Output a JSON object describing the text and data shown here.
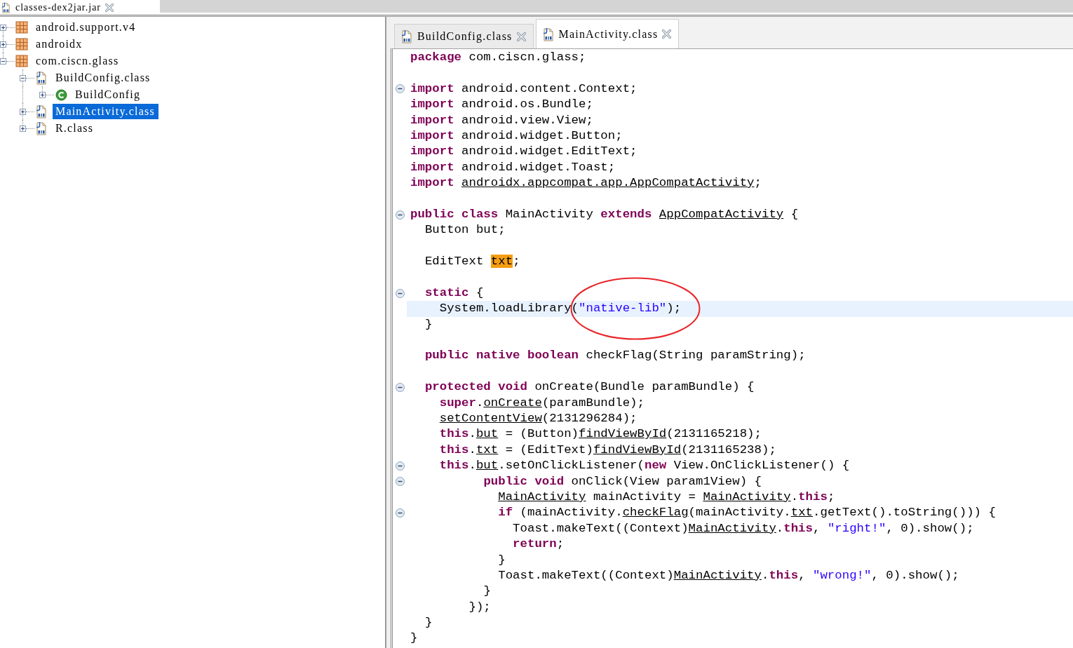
{
  "top_tab": {
    "label": "classes-dex2jar.jar"
  },
  "tree": [
    {
      "label": "android.support.v4",
      "kind": "package",
      "expanded": false,
      "selected": false
    },
    {
      "label": "androidx",
      "kind": "package",
      "expanded": false,
      "selected": false
    },
    {
      "label": "com.ciscn.glass",
      "kind": "package",
      "expanded": true,
      "selected": false,
      "children": [
        {
          "label": "BuildConfig.class",
          "kind": "classfile",
          "expanded": true,
          "selected": false,
          "children": [
            {
              "label": "BuildConfig",
              "kind": "class",
              "expanded": false,
              "selected": false
            }
          ]
        },
        {
          "label": "MainActivity.class",
          "kind": "classfile",
          "expanded": false,
          "selected": true
        },
        {
          "label": "R.class",
          "kind": "classfile",
          "expanded": false,
          "selected": false
        }
      ]
    }
  ],
  "editor_tabs": [
    {
      "label": "BuildConfig.class",
      "selected": false
    },
    {
      "label": "MainActivity.class",
      "selected": true
    }
  ],
  "code": [
    {
      "fold": false,
      "current": false,
      "tokens": [
        {
          "kind": "keyword",
          "text": "package "
        },
        {
          "kind": "plain",
          "text": "com.ciscn.glass;"
        }
      ]
    },
    {
      "fold": false,
      "current": false
    },
    {
      "fold": true,
      "current": false,
      "tokens": [
        {
          "kind": "keyword",
          "text": "import "
        },
        {
          "kind": "plain",
          "text": "android.content.Context;"
        }
      ]
    },
    {
      "fold": false,
      "current": false,
      "tokens": [
        {
          "kind": "keyword",
          "text": "import "
        },
        {
          "kind": "plain",
          "text": "android.os.Bundle;"
        }
      ]
    },
    {
      "fold": false,
      "current": false,
      "tokens": [
        {
          "kind": "keyword",
          "text": "import "
        },
        {
          "kind": "plain",
          "text": "android.view.View;"
        }
      ]
    },
    {
      "fold": false,
      "current": false,
      "tokens": [
        {
          "kind": "keyword",
          "text": "import "
        },
        {
          "kind": "plain",
          "text": "android.widget.Button;"
        }
      ]
    },
    {
      "fold": false,
      "current": false,
      "tokens": [
        {
          "kind": "keyword",
          "text": "import "
        },
        {
          "kind": "plain",
          "text": "android.widget.EditText;"
        }
      ]
    },
    {
      "fold": false,
      "current": false,
      "tokens": [
        {
          "kind": "keyword",
          "text": "import "
        },
        {
          "kind": "plain",
          "text": "android.widget.Toast;"
        }
      ]
    },
    {
      "fold": false,
      "current": false,
      "tokens": [
        {
          "kind": "keyword",
          "text": "import "
        },
        {
          "kind": "link",
          "text": "androidx.appcompat.app.AppCompatActivity"
        },
        {
          "kind": "plain",
          "text": ";"
        }
      ]
    },
    {
      "fold": false,
      "current": false
    },
    {
      "fold": true,
      "current": false,
      "tokens": [
        {
          "kind": "keyword",
          "text": "public class "
        },
        {
          "kind": "plain",
          "text": "MainActivity "
        },
        {
          "kind": "keyword",
          "text": "extends "
        },
        {
          "kind": "link",
          "text": "AppCompatActivity"
        },
        {
          "kind": "plain",
          "text": " {"
        }
      ]
    },
    {
      "fold": false,
      "current": false,
      "tokens": [
        {
          "kind": "plain",
          "text": "  Button but;"
        }
      ]
    },
    {
      "fold": false,
      "current": false
    },
    {
      "fold": false,
      "current": false,
      "tokens": [
        {
          "kind": "plain",
          "text": "  EditText "
        },
        {
          "kind": "match",
          "text": "txt"
        },
        {
          "kind": "plain",
          "text": ";"
        }
      ]
    },
    {
      "fold": false,
      "current": false
    },
    {
      "fold": true,
      "current": false,
      "tokens": [
        {
          "kind": "keyword",
          "text": "  static "
        },
        {
          "kind": "plain",
          "text": "{"
        }
      ]
    },
    {
      "fold": false,
      "current": true,
      "tokens": [
        {
          "kind": "plain",
          "text": "    System.loadLibrary("
        },
        {
          "kind": "circled",
          "text": "\"native-lib\""
        },
        {
          "kind": "plain",
          "text": ");"
        }
      ]
    },
    {
      "fold": false,
      "current": false,
      "tokens": [
        {
          "kind": "plain",
          "text": "  }"
        }
      ]
    },
    {
      "fold": false,
      "current": false
    },
    {
      "fold": false,
      "current": false,
      "tokens": [
        {
          "kind": "keyword",
          "text": "  public native boolean "
        },
        {
          "kind": "plain",
          "text": "checkFlag(String paramString);"
        }
      ]
    },
    {
      "fold": false,
      "current": false
    },
    {
      "fold": true,
      "current": false,
      "tokens": [
        {
          "kind": "keyword",
          "text": "  protected void "
        },
        {
          "kind": "plain",
          "text": "onCreate(Bundle paramBundle) {"
        }
      ]
    },
    {
      "fold": false,
      "current": false,
      "tokens": [
        {
          "kind": "keyword",
          "text": "    super"
        },
        {
          "kind": "plain",
          "text": "."
        },
        {
          "kind": "link",
          "text": "onCreate"
        },
        {
          "kind": "plain",
          "text": "(paramBundle);"
        }
      ]
    },
    {
      "fold": false,
      "current": false,
      "tokens": [
        {
          "kind": "link",
          "text": "    setContentView"
        },
        {
          "kind": "plain",
          "text": "(2131296284);"
        }
      ]
    },
    {
      "fold": false,
      "current": false,
      "tokens": [
        {
          "kind": "keyword",
          "text": "    this"
        },
        {
          "kind": "plain",
          "text": "."
        },
        {
          "kind": "link",
          "text": "but"
        },
        {
          "kind": "plain",
          "text": " = (Button)"
        },
        {
          "kind": "link",
          "text": "findViewById"
        },
        {
          "kind": "plain",
          "text": "(2131165218);"
        }
      ]
    },
    {
      "fold": false,
      "current": false,
      "tokens": [
        {
          "kind": "keyword",
          "text": "    this"
        },
        {
          "kind": "plain",
          "text": "."
        },
        {
          "kind": "link",
          "text": "txt"
        },
        {
          "kind": "plain",
          "text": " = (EditText)"
        },
        {
          "kind": "link",
          "text": "findViewById"
        },
        {
          "kind": "plain",
          "text": "(2131165238);"
        }
      ]
    },
    {
      "fold": true,
      "current": false,
      "tokens": [
        {
          "kind": "keyword",
          "text": "    this"
        },
        {
          "kind": "plain",
          "text": "."
        },
        {
          "kind": "link",
          "text": "but"
        },
        {
          "kind": "plain",
          "text": ".setOnClickListener("
        },
        {
          "kind": "keyword",
          "text": "new "
        },
        {
          "kind": "plain",
          "text": "View.OnClickListener() {"
        }
      ]
    },
    {
      "fold": true,
      "current": false,
      "tokens": [
        {
          "kind": "keyword",
          "text": "          public void "
        },
        {
          "kind": "plain",
          "text": "onClick(View param1View) {"
        }
      ]
    },
    {
      "fold": false,
      "current": false,
      "tokens": [
        {
          "kind": "link",
          "text": "            MainActivity"
        },
        {
          "kind": "plain",
          "text": " mainActivity = "
        },
        {
          "kind": "link",
          "text": "MainActivity"
        },
        {
          "kind": "plain",
          "text": "."
        },
        {
          "kind": "keyword",
          "text": "this"
        },
        {
          "kind": "plain",
          "text": ";"
        }
      ]
    },
    {
      "fold": true,
      "current": false,
      "tokens": [
        {
          "kind": "keyword",
          "text": "            if "
        },
        {
          "kind": "plain",
          "text": "(mainActivity."
        },
        {
          "kind": "link",
          "text": "checkFlag"
        },
        {
          "kind": "plain",
          "text": "(mainActivity."
        },
        {
          "kind": "link",
          "text": "txt"
        },
        {
          "kind": "plain",
          "text": ".getText().toString())) {"
        }
      ]
    },
    {
      "fold": false,
      "current": false,
      "tokens": [
        {
          "kind": "plain",
          "text": "              Toast.makeText((Context)"
        },
        {
          "kind": "link",
          "text": "MainActivity"
        },
        {
          "kind": "plain",
          "text": "."
        },
        {
          "kind": "keyword",
          "text": "this"
        },
        {
          "kind": "plain",
          "text": ", "
        },
        {
          "kind": "string",
          "text": "\"right!\""
        },
        {
          "kind": "plain",
          "text": ", 0).show();"
        }
      ]
    },
    {
      "fold": false,
      "current": false,
      "tokens": [
        {
          "kind": "keyword",
          "text": "              return"
        },
        {
          "kind": "plain",
          "text": ";"
        }
      ]
    },
    {
      "fold": false,
      "current": false,
      "tokens": [
        {
          "kind": "plain",
          "text": "            }"
        }
      ]
    },
    {
      "fold": false,
      "current": false,
      "tokens": [
        {
          "kind": "plain",
          "text": "            Toast.makeText((Context)"
        },
        {
          "kind": "link",
          "text": "MainActivity"
        },
        {
          "kind": "plain",
          "text": "."
        },
        {
          "kind": "keyword",
          "text": "this"
        },
        {
          "kind": "plain",
          "text": ", "
        },
        {
          "kind": "string",
          "text": "\"wrong!\""
        },
        {
          "kind": "plain",
          "text": ", 0).show();"
        }
      ]
    },
    {
      "fold": false,
      "current": false,
      "tokens": [
        {
          "kind": "plain",
          "text": "          }"
        }
      ]
    },
    {
      "fold": false,
      "current": false,
      "tokens": [
        {
          "kind": "plain",
          "text": "        });"
        }
      ]
    },
    {
      "fold": false,
      "current": false,
      "tokens": [
        {
          "kind": "plain",
          "text": "  }"
        }
      ]
    },
    {
      "fold": false,
      "current": false,
      "tokens": [
        {
          "kind": "plain",
          "text": "}"
        }
      ]
    }
  ]
}
